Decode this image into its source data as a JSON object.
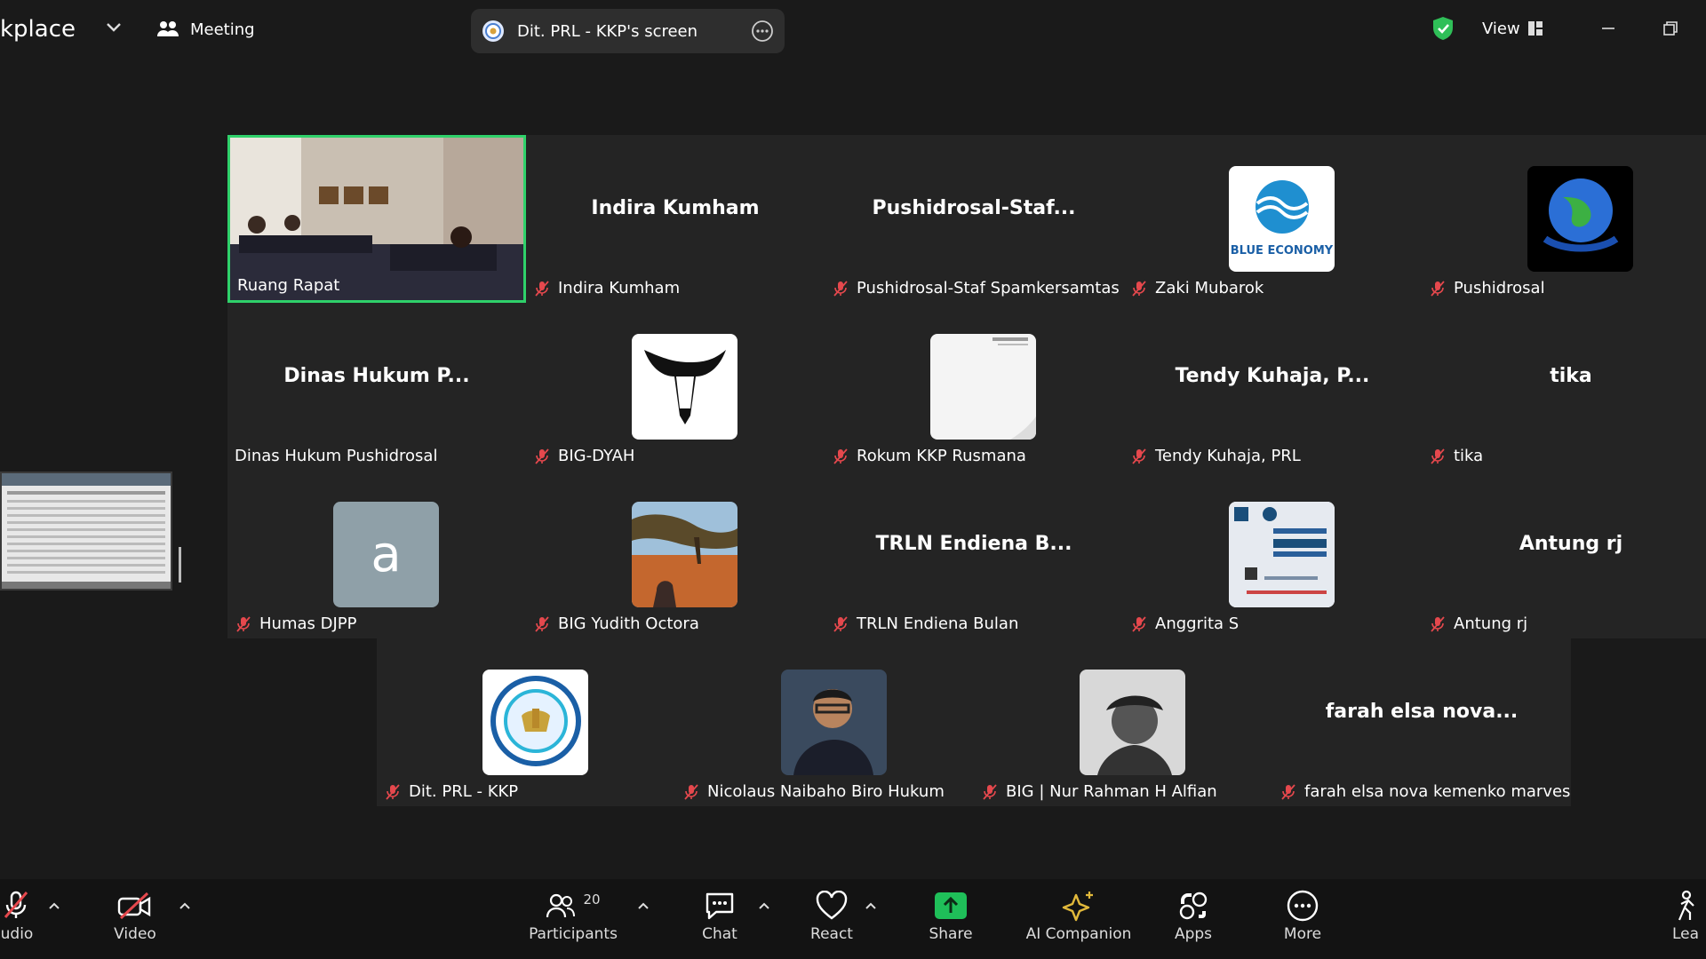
{
  "topbar": {
    "app_title": "kplace",
    "meeting_label": "Meeting",
    "share_label": "Dit. PRL - KKP's screen",
    "view_label": "View"
  },
  "tiles": [
    {
      "name": "Ruang Rapat",
      "big": ""
    },
    {
      "name": "Indira Kumham",
      "big": "Indira Kumham"
    },
    {
      "name": "Pushidrosal-Staf Spamkersamtas",
      "big": "Pushidrosal-Staf..."
    },
    {
      "name": "Zaki Mubarok",
      "big": "",
      "avatar_text": "BLUE ECONOMY"
    },
    {
      "name": "Pushidrosal",
      "big": ""
    },
    {
      "name": "Dinas Hukum Pushidrosal",
      "big": "Dinas Hukum P..."
    },
    {
      "name": "BIG-DYAH",
      "big": ""
    },
    {
      "name": "Rokum KKP Rusmana",
      "big": ""
    },
    {
      "name": "Tendy Kuhaja, PRL",
      "big": "Tendy Kuhaja, P..."
    },
    {
      "name": "tika",
      "big": "tika"
    },
    {
      "name": "Humas DJPP",
      "big": "",
      "avatar_text": "a"
    },
    {
      "name": "BIG Yudith Octora",
      "big": ""
    },
    {
      "name": "TRLN Endiena Bulan",
      "big": "TRLN Endiena B..."
    },
    {
      "name": "Anggrita S",
      "big": ""
    },
    {
      "name": "Antung rj",
      "big": "Antung rj"
    },
    {
      "name": "Dit. PRL - KKP",
      "big": ""
    },
    {
      "name": "Nicolaus Naibaho Biro Hukum",
      "big": ""
    },
    {
      "name": "BIG | Nur Rahman H Alfian",
      "big": ""
    },
    {
      "name": "farah elsa nova kemenko marves",
      "big": "farah elsa nova..."
    }
  ],
  "toolbar": {
    "audio": "udio",
    "video": "Video",
    "participants": "Participants",
    "participant_count": "20",
    "chat": "Chat",
    "react": "React",
    "share": "Share",
    "ai_companion": "AI Companion",
    "apps": "Apps",
    "more": "More",
    "leave": "Lea"
  },
  "colors": {
    "active_border": "#2fd16a",
    "share_green": "#1fbf59",
    "mic_muted": "#e5484d",
    "ai_gold": "#e2b93b"
  }
}
